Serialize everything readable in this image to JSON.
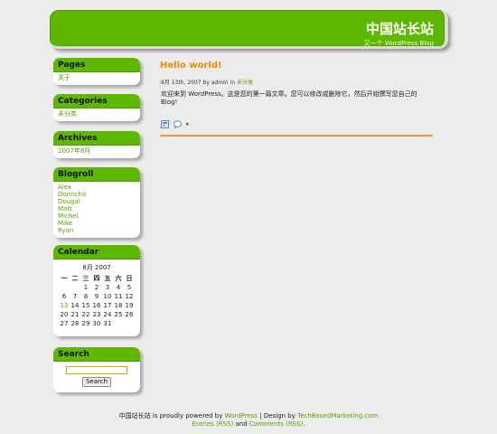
{
  "header": {
    "site_title": "中国站长站",
    "site_description": "又一个 WordPress Blog"
  },
  "sidebar": {
    "pages": {
      "title": "Pages",
      "items": [
        "关于"
      ]
    },
    "categories": {
      "title": "Categories",
      "items": [
        "未分类"
      ]
    },
    "archives": {
      "title": "Archives",
      "items": [
        "2007年8月"
      ]
    },
    "blogroll": {
      "title": "Blogroll",
      "items": [
        "Alex",
        "Donncha",
        "Dougal",
        "Matt",
        "Michel",
        "Mike",
        "Ryan"
      ]
    },
    "calendar": {
      "title": "Calendar",
      "caption": "8月 2007",
      "weekdays": [
        "一",
        "二",
        "三",
        "四",
        "五",
        "六",
        "日"
      ],
      "weeks": [
        [
          "",
          "",
          "1",
          "2",
          "3",
          "4",
          "5"
        ],
        [
          "6",
          "7",
          "8",
          "9",
          "10",
          "11",
          "12"
        ],
        [
          "13",
          "14",
          "15",
          "16",
          "17",
          "18",
          "19"
        ],
        [
          "20",
          "21",
          "22",
          "23",
          "24",
          "25",
          "26"
        ],
        [
          "27",
          "28",
          "29",
          "30",
          "31",
          "",
          ""
        ]
      ],
      "linked_day": "13"
    },
    "search": {
      "title": "Search",
      "input_value": "",
      "button_label": "Search"
    }
  },
  "post": {
    "title": "Hello world!",
    "meta_date": "8月 13th, 2007",
    "meta_by": "by",
    "meta_author": "admin",
    "meta_in": "in",
    "meta_category": "未分类",
    "body": "欢迎来到 WordPress。这是您的第一篇文章。您可以修改或删除它，然后开始撰写您自己的 Blog!",
    "comment_arrow": "▸"
  },
  "footer": {
    "site_name": "中国站长站",
    "powered_text": "is proudly powered by",
    "wordpress_link": "WordPress",
    "separator": "|",
    "design_text": "Design by",
    "designer_link": "TechBasedMarketing.com",
    "entries_link": "Entries (RSS)",
    "and_text": "and",
    "comments_link": "Comments (RSS)",
    "period": "."
  }
}
